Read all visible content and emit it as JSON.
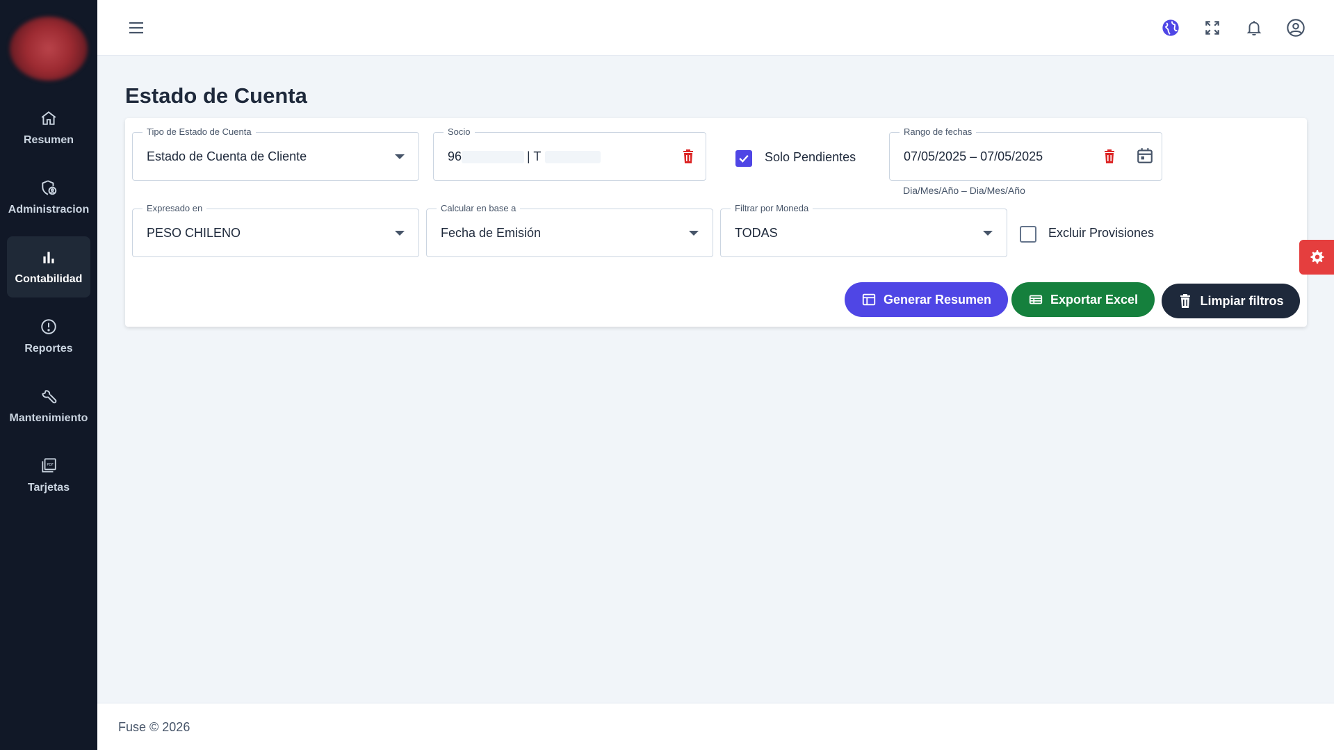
{
  "sidebar": {
    "items": [
      {
        "label": "Resumen",
        "icon": "home-icon"
      },
      {
        "label": "Administracion",
        "icon": "shield-user-icon"
      },
      {
        "label": "Contabilidad",
        "icon": "bar-chart-icon",
        "active": true
      },
      {
        "label": "Reportes",
        "icon": "alert-circle-icon"
      },
      {
        "label": "Mantenimiento",
        "icon": "wrench-icon"
      },
      {
        "label": "Tarjetas",
        "icon": "pdf-stack-icon"
      }
    ]
  },
  "topbar": {
    "icons": [
      "menu-icon",
      "globe-icon",
      "fullscreen-icon",
      "bell-icon",
      "user-circle-icon"
    ]
  },
  "page": {
    "title": "Estado de Cuenta"
  },
  "filters": {
    "tipo": {
      "label": "Tipo de Estado de Cuenta",
      "value": "Estado de Cuenta de Cliente"
    },
    "socio": {
      "label": "Socio",
      "value_prefix": "96",
      "value_mid": "| T"
    },
    "solo_pendientes": {
      "label": "Solo Pendientes",
      "checked": true
    },
    "rango": {
      "label": "Rango de fechas",
      "value": "07/05/2025 – 07/05/2025",
      "hint": "Dia/Mes/Año – Dia/Mes/Año"
    },
    "expresado": {
      "label": "Expresado en",
      "value": "PESO CHILENO"
    },
    "calcular": {
      "label": "Calcular en base a",
      "value": "Fecha de Emisión"
    },
    "moneda": {
      "label": "Filtrar por Moneda",
      "value": "TODAS"
    },
    "excluir": {
      "label": "Excluir Provisiones",
      "checked": false
    }
  },
  "actions": {
    "generar": "Generar Resumen",
    "exportar": "Exportar Excel",
    "limpiar": "Limpiar filtros"
  },
  "colors": {
    "sidebar_bg": "#111827",
    "primary": "#4f46e5",
    "success": "#15803d",
    "dark": "#1e293b",
    "danger": "#dc2626"
  },
  "footer": {
    "text": "Fuse © 2026"
  }
}
